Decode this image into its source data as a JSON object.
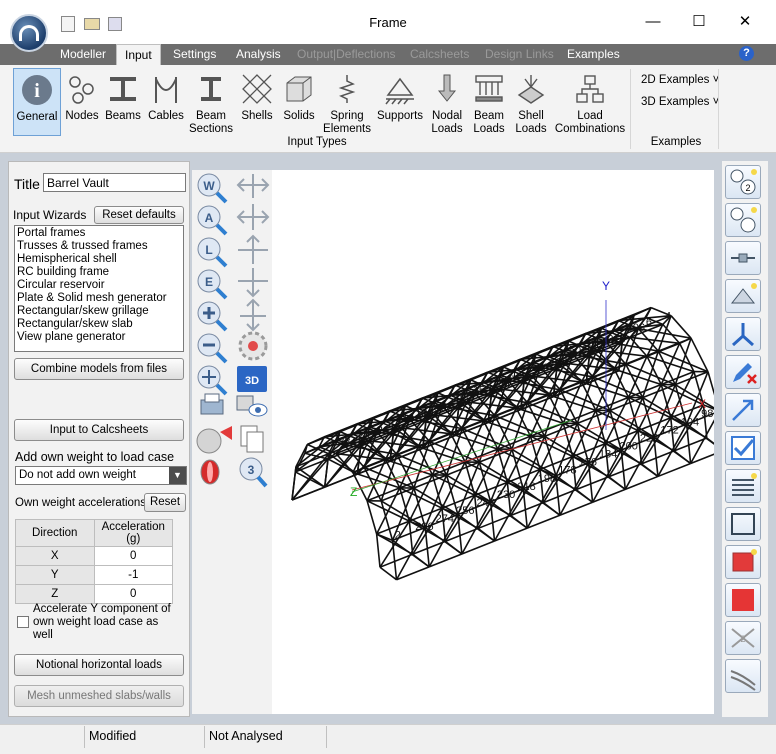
{
  "window": {
    "title": "Frame",
    "minimize": "—",
    "maximize": "☐",
    "close": "✕"
  },
  "tabs": [
    {
      "label": "Modeller",
      "state": "normal"
    },
    {
      "label": "Input",
      "state": "active"
    },
    {
      "label": "Settings",
      "state": "normal"
    },
    {
      "label": "Analysis",
      "state": "normal"
    },
    {
      "label": "Output|Deflections",
      "state": "disabled"
    },
    {
      "label": "Calcsheets",
      "state": "disabled"
    },
    {
      "label": "Design Links",
      "state": "disabled"
    },
    {
      "label": "Examples",
      "state": "normal"
    }
  ],
  "help": "?",
  "ribbon": {
    "buttons": [
      {
        "label": "General",
        "icon": "info-icon"
      },
      {
        "label": "Nodes",
        "icon": "nodes-icon"
      },
      {
        "label": "Beams",
        "icon": "beams-icon"
      },
      {
        "label": "Cables",
        "icon": "cables-icon"
      },
      {
        "label": "Beam\nSections",
        "icon": "beam-sections-icon"
      },
      {
        "label": "Shells",
        "icon": "shells-icon"
      },
      {
        "label": "Solids",
        "icon": "solids-icon"
      },
      {
        "label": "Spring\nElements",
        "icon": "spring-icon"
      },
      {
        "label": "Supports",
        "icon": "supports-icon"
      },
      {
        "label": "Nodal\nLoads",
        "icon": "nodal-loads-icon"
      },
      {
        "label": "Beam\nLoads",
        "icon": "beam-loads-icon"
      },
      {
        "label": "Shell\nLoads",
        "icon": "shell-loads-icon"
      },
      {
        "label": "Load\nCombinations",
        "icon": "load-combinations-icon"
      }
    ],
    "group_input": "Input Types",
    "examples_2d": "2D Examples ˅",
    "examples_3d": "3D Examples ˅",
    "group_examples": "Examples"
  },
  "left": {
    "title_label": "Title",
    "title_value": "Barrel Vault",
    "wizards_label": "Input Wizards",
    "reset_defaults": "Reset defaults",
    "wizards": [
      "Portal frames",
      "Trusses & trussed frames",
      "Hemispherical shell",
      "RC building frame",
      "Circular reservoir",
      "Plate & Solid mesh generator",
      "Rectangular/skew grillage",
      "Rectangular/skew slab",
      "View plane generator"
    ],
    "combine_models": "Combine models from files",
    "input_to_calcsheets": "Input to Calcsheets",
    "add_weight_label": "Add own weight to load case",
    "add_weight_value": "Do not add own weight",
    "accel_label": "Own weight accelerations",
    "reset": "Reset",
    "table_headers": [
      "Direction",
      "Acceleration (g)"
    ],
    "table_rows": [
      [
        "X",
        "0"
      ],
      [
        "Y",
        "-1"
      ],
      [
        "Z",
        "0"
      ]
    ],
    "accelerate_checkbox": "Accelerate Y component of own weight load case as well",
    "notional_loads": "Notional horizontal loads",
    "mesh_unmeshed": "Mesh unmeshed slabs/walls"
  },
  "viewport": {
    "axis_x": "X",
    "axis_y": "Y",
    "axis_z": "Z",
    "node_labels": [
      "234",
      "232",
      "212",
      "210",
      "180",
      "188",
      "166",
      "152",
      "144",
      "132",
      "126",
      "108",
      "503",
      "412",
      "310",
      "306",
      "6",
      "4",
      "2",
      "296",
      "274",
      "256",
      "248",
      "230",
      "218",
      "198",
      "178",
      "156",
      "134",
      "200",
      "222",
      "172",
      "104",
      "98"
    ]
  },
  "toolstrip": {
    "zoom_w": "W",
    "zoom_a": "A",
    "zoom_l": "L",
    "zoom_e": "E",
    "zoom_3": "3",
    "view_3d": "3D"
  },
  "status": {
    "modified": "Modified",
    "analysis": "Not Analysed"
  }
}
